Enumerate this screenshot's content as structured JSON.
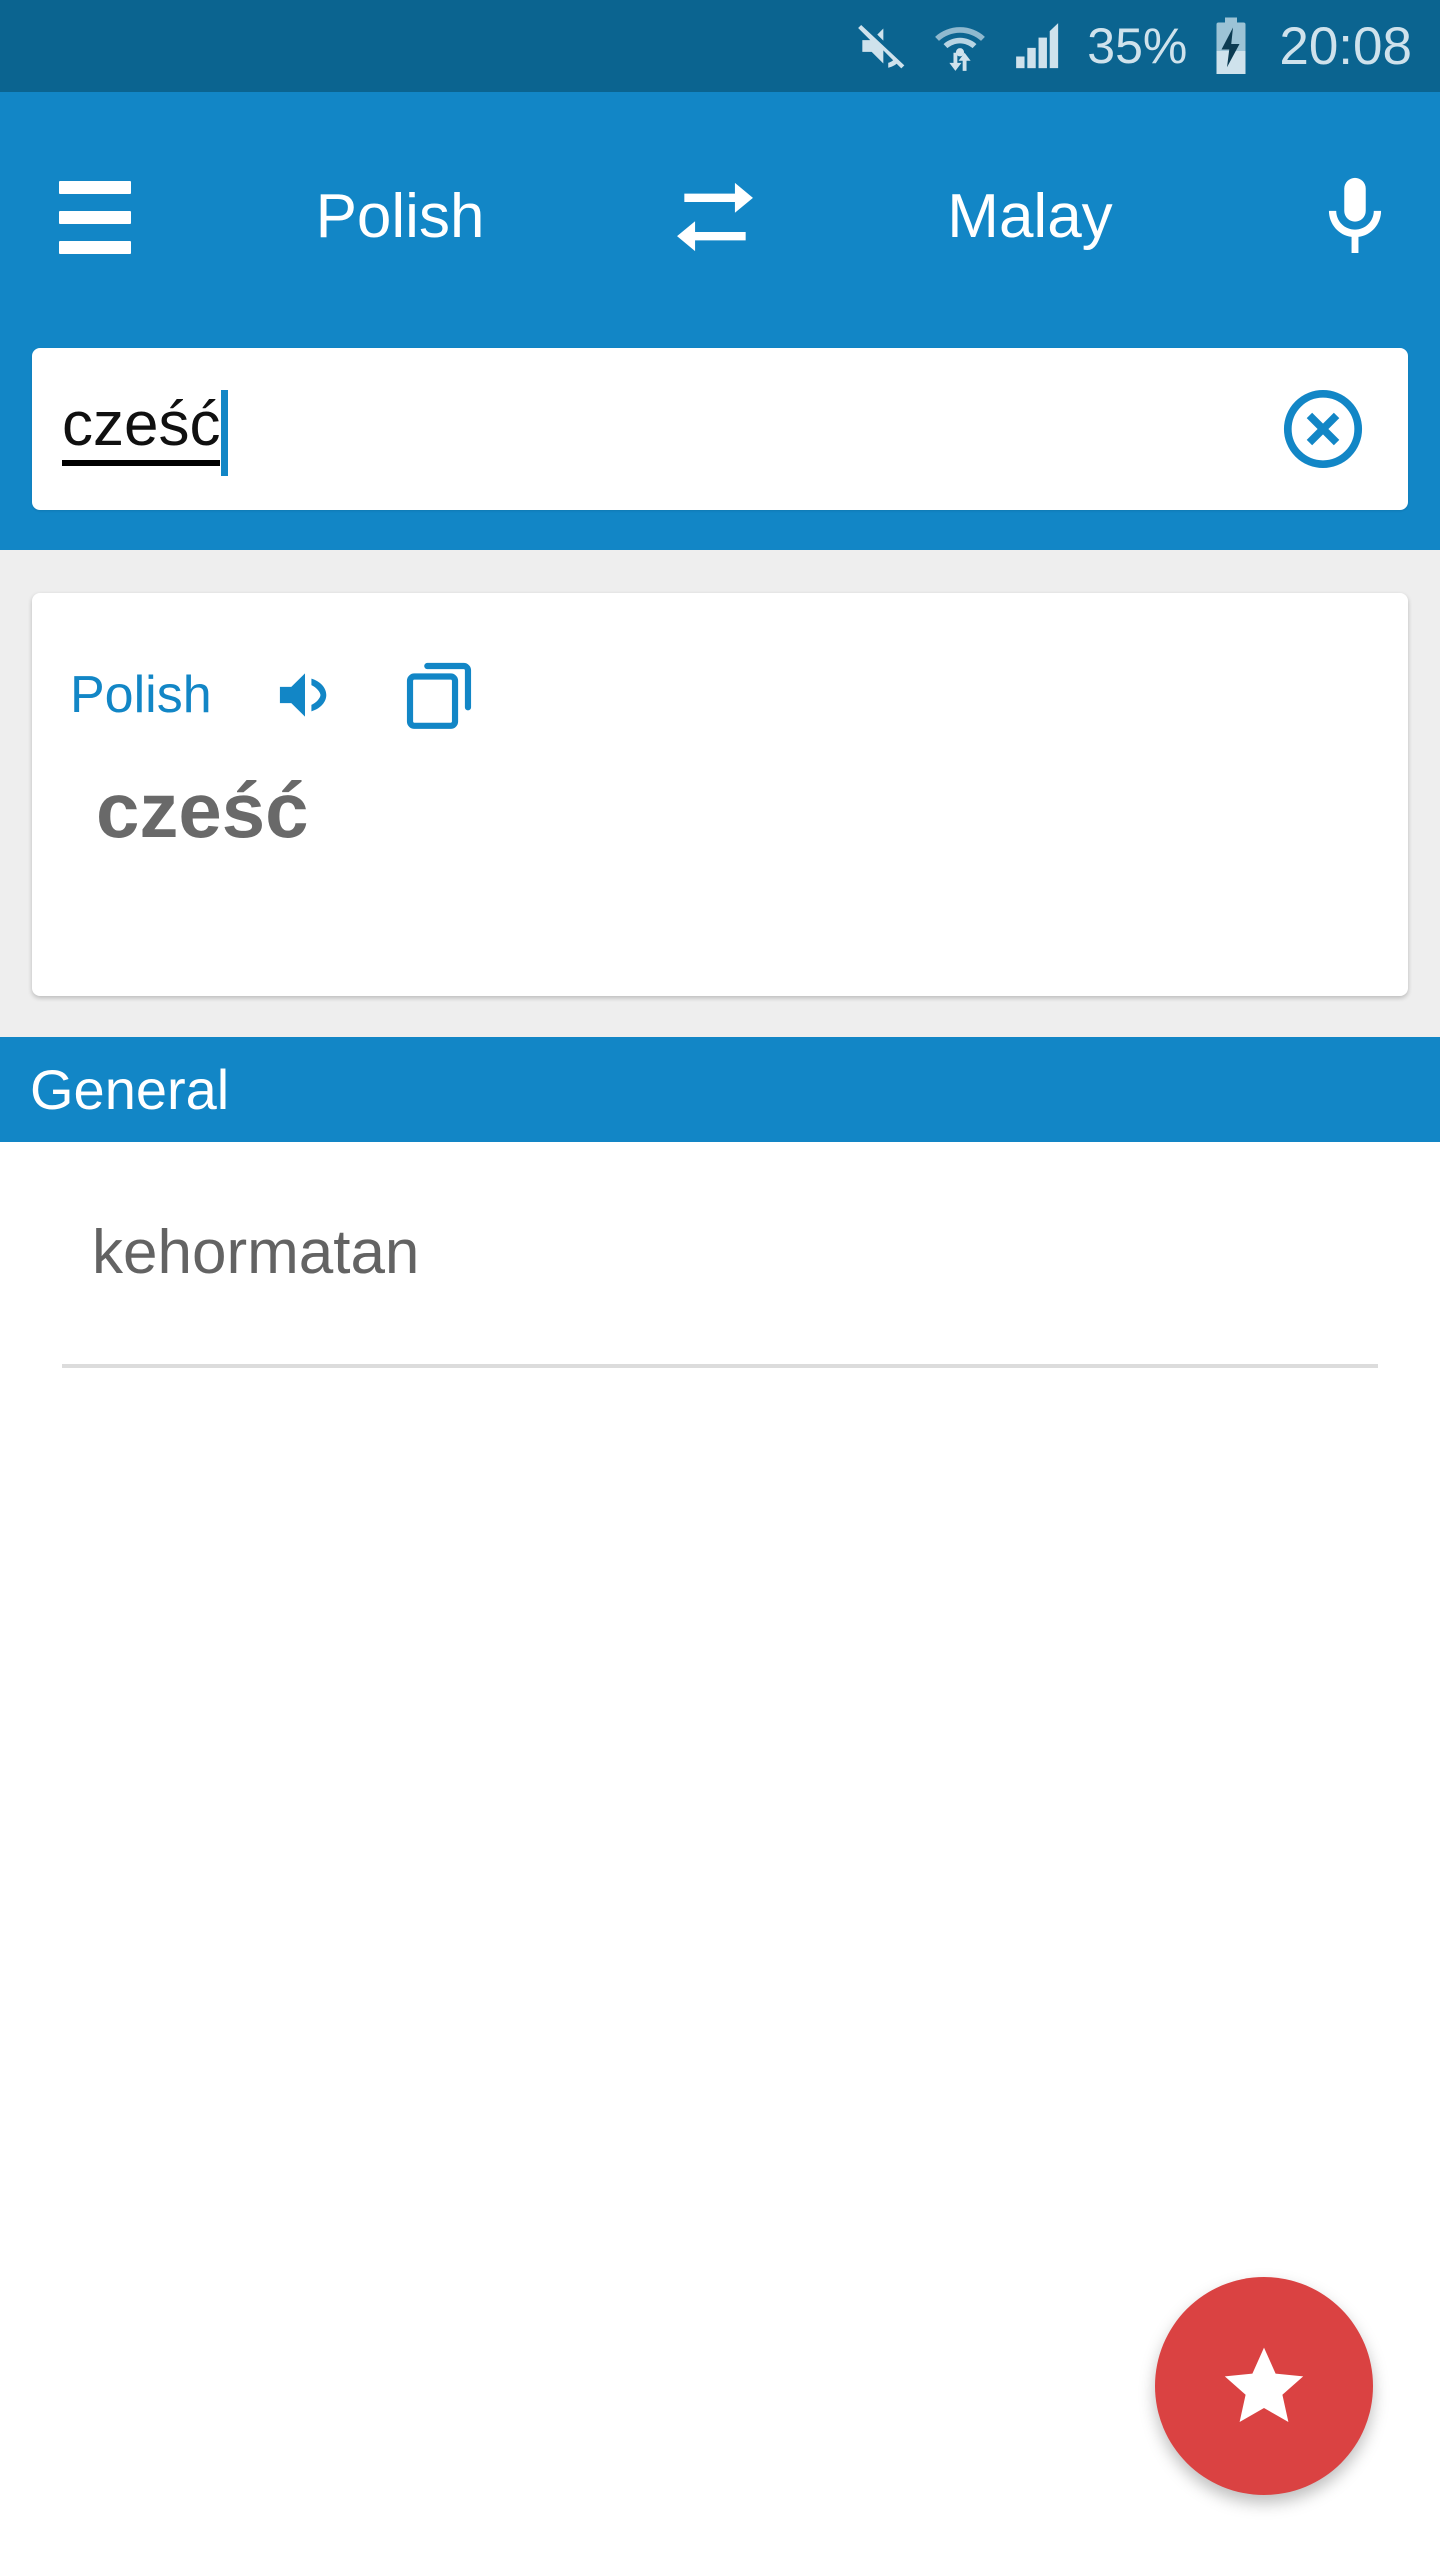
{
  "status_bar": {
    "background": "#0b6490",
    "mute_icon": "mute-icon",
    "wifi_icon": "wifi-transfer-icon",
    "signal_icon": "signal-bars-icon",
    "battery_percent": "35%",
    "battery_icon": "battery-charging-icon",
    "clock": "20:08"
  },
  "app_bar": {
    "background": "#1286c6",
    "menu_icon": "hamburger-menu-icon",
    "source_language": "Polish",
    "swap_icon": "swap-horizontal-icon",
    "target_language": "Malay",
    "mic_icon": "microphone-icon"
  },
  "search": {
    "value": "cześć",
    "placeholder": "",
    "clear_icon": "clear-circle-icon"
  },
  "source_card": {
    "language_label": "Polish",
    "speaker_icon": "speaker-volume-icon",
    "copy_icon": "copy-icon",
    "word": "cześć"
  },
  "section": {
    "title": "General",
    "background": "#1286c6"
  },
  "results": [
    {
      "word": "kehormatan"
    }
  ],
  "fab": {
    "icon": "star-icon",
    "color": "#da4242"
  }
}
